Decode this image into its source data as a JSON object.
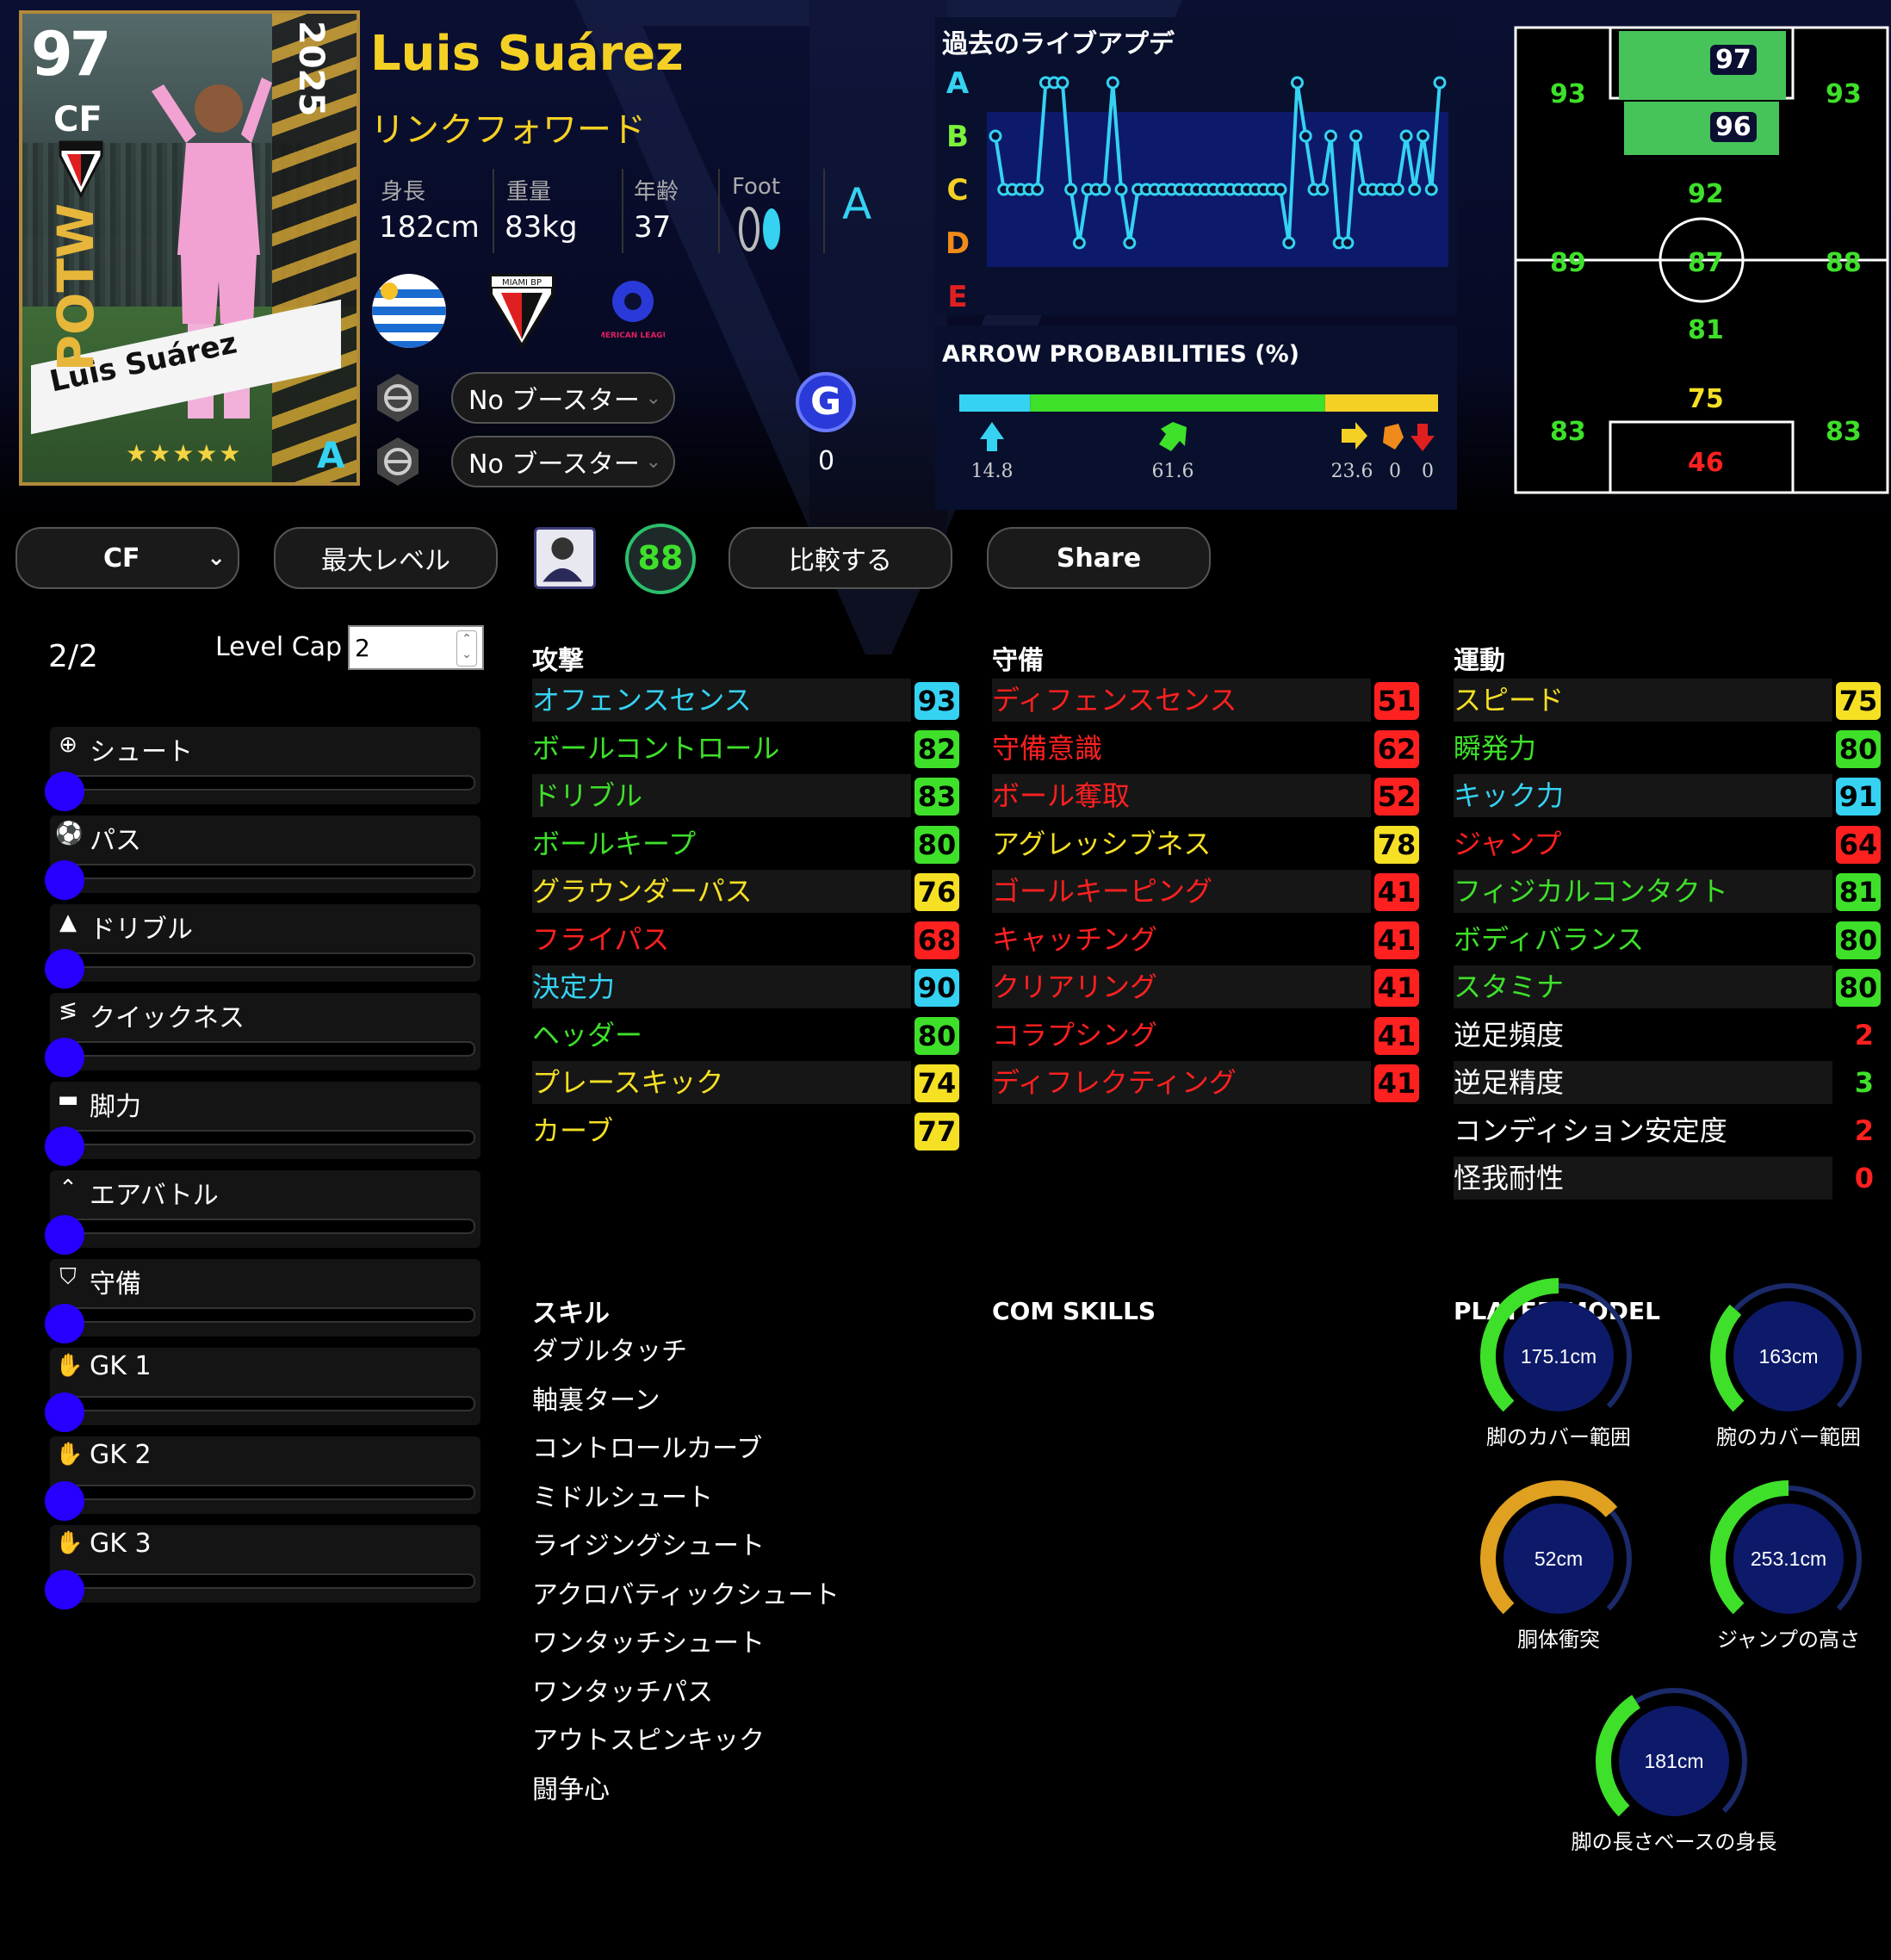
{
  "card": {
    "rating": "97",
    "position": "CF",
    "club_badge_text": "MIAMI BP",
    "year": "2025",
    "edition": "POTW",
    "name": "Luis Suárez",
    "stars": "★★★★★",
    "grade": "A"
  },
  "player": {
    "name": "Luis Suárez",
    "position_jp": "リンクフォワード",
    "height_label": "身長",
    "height": "182cm",
    "weight_label": "重量",
    "weight": "83kg",
    "age_label": "年齢",
    "age": "37",
    "foot_label": "Foot",
    "condition": "A",
    "club_label": "MIAMI BP",
    "league_label": "AMERICAN LEAGUE"
  },
  "boosters": [
    {
      "label": "No ブースター"
    },
    {
      "label": "No ブースター"
    }
  ],
  "g_badge": {
    "letter": "G",
    "count": "0"
  },
  "live_update": {
    "title": "過去のライブアプデ",
    "grades": [
      "A",
      "B",
      "C",
      "D",
      "E"
    ],
    "grade_colors": [
      "#35d2f2",
      "#7cf23a",
      "#f5d024",
      "#f08a1a",
      "#e02020"
    ],
    "history": [
      "B",
      "C",
      "C",
      "C",
      "C",
      "C",
      "A",
      "A",
      "A",
      "C",
      "D",
      "C",
      "C",
      "C",
      "A",
      "C",
      "D",
      "C",
      "C",
      "C",
      "C",
      "C",
      "C",
      "C",
      "C",
      "C",
      "C",
      "C",
      "C",
      "C",
      "C",
      "C",
      "C",
      "C",
      "C",
      "D",
      "A",
      "B",
      "C",
      "C",
      "B",
      "D",
      "D",
      "B",
      "C",
      "C",
      "C",
      "C",
      "C",
      "B",
      "C",
      "B",
      "C",
      "A"
    ]
  },
  "arrow_probabilities": {
    "title": "ARROW PROBABILITIES (%)",
    "segments": [
      {
        "value": 14.8,
        "color": "#35d2f2"
      },
      {
        "value": 61.6,
        "color": "#3ee02a"
      },
      {
        "value": 23.6,
        "color": "#f5d024"
      },
      {
        "value": 0,
        "color": "#f08a1a"
      },
      {
        "value": 0,
        "color": "#e02020"
      }
    ],
    "labels": [
      "14.8",
      "61.6",
      "23.6",
      "0",
      "0"
    ]
  },
  "position_map": {
    "gk_top": "97",
    "cf": "96",
    "lw": "93",
    "rw": "93",
    "amf": "92",
    "lmf": "89",
    "cmf": "87",
    "rmf": "88",
    "dmf": "81",
    "cb": "75",
    "lb": "83",
    "rb": "83",
    "gk": "46"
  },
  "toolbar": {
    "position_select": "CF",
    "max_level": "最大レベル",
    "overall": "88",
    "compare": "比較する",
    "share": "Share"
  },
  "level": {
    "progress": "2/2",
    "cap_label": "Level Cap",
    "cap_value": "2"
  },
  "progression": [
    {
      "label": "シュート",
      "icon": "crosshair-icon",
      "glyph": "⊕"
    },
    {
      "label": "パス",
      "icon": "ball-icon",
      "glyph": "⚽"
    },
    {
      "label": "ドリブル",
      "icon": "cone-icon",
      "glyph": "▲"
    },
    {
      "label": "クイックネス",
      "icon": "speed-icon",
      "glyph": "≶"
    },
    {
      "label": "脚力",
      "icon": "boot-icon",
      "glyph": "▬"
    },
    {
      "label": "エアバトル",
      "icon": "chevrons-up-icon",
      "glyph": "⌃"
    },
    {
      "label": "守備",
      "icon": "shield-icon",
      "glyph": "⛉"
    },
    {
      "label": "GK 1",
      "icon": "glove-icon",
      "glyph": "✋"
    },
    {
      "label": "GK 2",
      "icon": "glove-icon",
      "glyph": "✋"
    },
    {
      "label": "GK 3",
      "icon": "glove-icon",
      "glyph": "✋"
    }
  ],
  "attack": {
    "title": "攻撃",
    "stats": [
      {
        "name": "オフェンスセンス",
        "value": "93",
        "color": "#35d2f2"
      },
      {
        "name": "ボールコントロール",
        "value": "82",
        "color": "#3ee02a"
      },
      {
        "name": "ドリブル",
        "value": "83",
        "color": "#3ee02a"
      },
      {
        "name": "ボールキープ",
        "value": "80",
        "color": "#3ee02a"
      },
      {
        "name": "グラウンダーパス",
        "value": "76",
        "color": "#f5e024"
      },
      {
        "name": "フライパス",
        "value": "68",
        "color": "#ff2020"
      },
      {
        "name": "決定力",
        "value": "90",
        "color": "#35d2f2"
      },
      {
        "name": "ヘッダー",
        "value": "80",
        "color": "#3ee02a"
      },
      {
        "name": "プレースキック",
        "value": "74",
        "color": "#f5e024"
      },
      {
        "name": "カーブ",
        "value": "77",
        "color": "#f5e024"
      }
    ]
  },
  "defense": {
    "title": "守備",
    "stats": [
      {
        "name": "ディフェンスセンス",
        "value": "51",
        "color": "#ff2020"
      },
      {
        "name": "守備意識",
        "value": "62",
        "color": "#ff2020"
      },
      {
        "name": "ボール奪取",
        "value": "52",
        "color": "#ff2020"
      },
      {
        "name": "アグレッシブネス",
        "value": "78",
        "color": "#f5e024"
      },
      {
        "name": "ゴールキーピング",
        "value": "41",
        "color": "#ff2020"
      },
      {
        "name": "キャッチング",
        "value": "41",
        "color": "#ff2020"
      },
      {
        "name": "クリアリング",
        "value": "41",
        "color": "#ff2020"
      },
      {
        "name": "コラプシング",
        "value": "41",
        "color": "#ff2020"
      },
      {
        "name": "ディフレクティング",
        "value": "41",
        "color": "#ff2020"
      }
    ]
  },
  "physical": {
    "title": "運動",
    "stats": [
      {
        "name": "スピード",
        "value": "75",
        "color": "#f5e024",
        "type": "box"
      },
      {
        "name": "瞬発力",
        "value": "80",
        "color": "#3ee02a",
        "type": "box"
      },
      {
        "name": "キック力",
        "value": "91",
        "color": "#35d2f2",
        "type": "box"
      },
      {
        "name": "ジャンプ",
        "value": "64",
        "color": "#ff2020",
        "type": "box"
      },
      {
        "name": "フィジカルコンタクト",
        "value": "81",
        "color": "#3ee02a",
        "type": "box"
      },
      {
        "name": "ボディバランス",
        "value": "80",
        "color": "#3ee02a",
        "type": "box"
      },
      {
        "name": "スタミナ",
        "value": "80",
        "color": "#3ee02a",
        "type": "box"
      },
      {
        "name": "逆足頻度",
        "value": "2",
        "color": "#ff2020",
        "type": "plain"
      },
      {
        "name": "逆足精度",
        "value": "3",
        "color": "#3ee02a",
        "type": "plain"
      },
      {
        "name": "コンディション安定度",
        "value": "2",
        "color": "#ff2020",
        "type": "plain"
      },
      {
        "name": "怪我耐性",
        "value": "0",
        "color": "#ff2020",
        "type": "plain"
      }
    ]
  },
  "skills": {
    "title": "スキル",
    "items": [
      "ダブルタッチ",
      "軸裏ターン",
      "コントロールカーブ",
      "ミドルシュート",
      "ライジングシュート",
      "アクロバティックシュート",
      "ワンタッチシュート",
      "ワンタッチパス",
      "アウトスピンキック",
      "闘争心"
    ]
  },
  "com_skills": {
    "title": "COM SKILLS"
  },
  "player_model": {
    "title": "PLAYER MODEL",
    "gauges": [
      {
        "value": "175.1cm",
        "label": "脚のカバー範囲",
        "fill": 0.5
      },
      {
        "value": "163cm",
        "label": "腕のカバー範囲",
        "fill": 0.32
      },
      {
        "value": "52cm",
        "label": "胴体衝突",
        "fill": 0.68
      },
      {
        "value": "253.1cm",
        "label": "ジャンプの高さ",
        "fill": 0.5
      },
      {
        "value": "181cm",
        "label": "脚の長さベースの身長",
        "fill": 0.38
      }
    ]
  }
}
